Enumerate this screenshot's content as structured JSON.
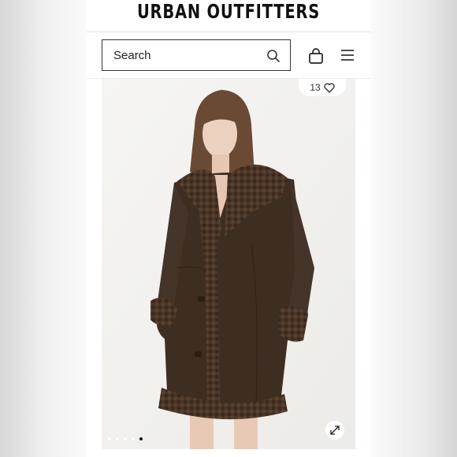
{
  "brand": {
    "name": "URBAN OUTFITTERS"
  },
  "search": {
    "placeholder": "Search"
  },
  "header": {
    "icons": [
      "search-icon",
      "shopping-bag-icon",
      "hamburger-menu-icon"
    ]
  },
  "product": {
    "favorite_count": "13",
    "favorite_icon": "heart-outline-icon",
    "expand_icon": "expand-arrows-icon",
    "image_index_current": 5,
    "image_count": 5
  },
  "colors": {
    "text": "#111111",
    "coat": "#3e2e22",
    "sherpa": "#4a3526"
  }
}
